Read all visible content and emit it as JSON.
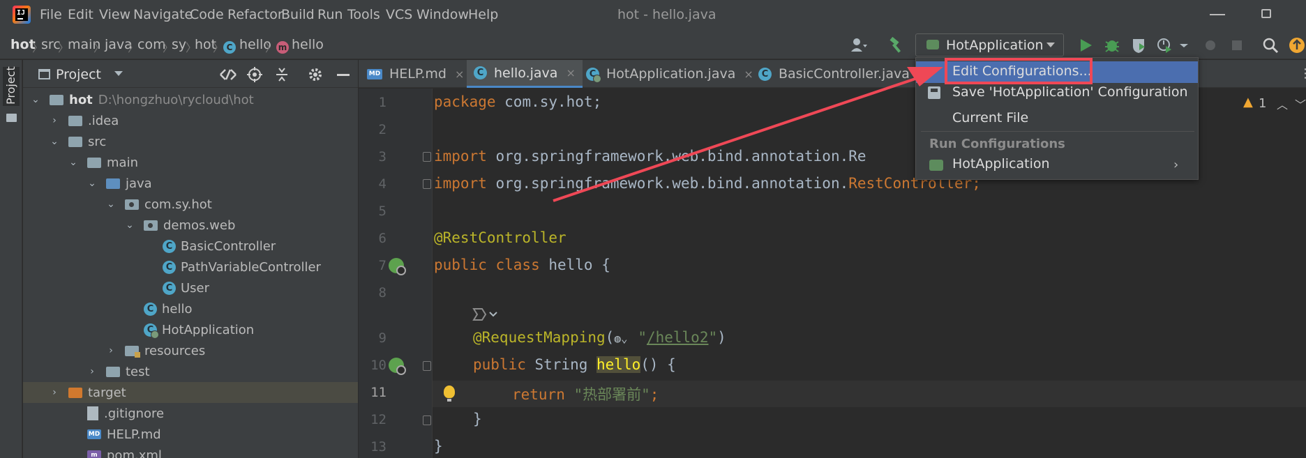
{
  "menubar": {
    "items": [
      "File",
      "Edit",
      "View",
      "Navigate",
      "Code",
      "Refactor",
      "Build",
      "Run",
      "Tools",
      "VCS",
      "Window",
      "Help"
    ],
    "window_title": "hot - hello.java"
  },
  "breadcrumb": [
    "hot",
    "src",
    "main",
    "java",
    "com",
    "sy",
    "hot",
    "hello",
    "hello"
  ],
  "run_config": {
    "selected": "HotApplication"
  },
  "left_strip": {
    "label": "Project"
  },
  "project_panel": {
    "title": "Project",
    "tree": [
      {
        "label": "hot",
        "extra": "D:\\hongzhuo\\rycloud\\hot"
      },
      {
        "label": ".idea"
      },
      {
        "label": "src"
      },
      {
        "label": "main"
      },
      {
        "label": "java"
      },
      {
        "label": "com.sy.hot"
      },
      {
        "label": "demos.web"
      },
      {
        "label": "BasicController"
      },
      {
        "label": "PathVariableController"
      },
      {
        "label": "User"
      },
      {
        "label": "hello"
      },
      {
        "label": "HotApplication"
      },
      {
        "label": "resources"
      },
      {
        "label": "test"
      },
      {
        "label": "target"
      },
      {
        "label": ".gitignore"
      },
      {
        "label": "HELP.md"
      },
      {
        "label": "pom.xml"
      }
    ],
    "md_badge": "MD",
    "class_badge": "C"
  },
  "tabs": [
    {
      "label": "HELP.md",
      "badge": "MD"
    },
    {
      "label": "hello.java",
      "badge": "C"
    },
    {
      "label": "HotApplication.java",
      "badge": "C"
    },
    {
      "label": "BasicController.java",
      "badge": "C"
    }
  ],
  "tab_close": "×",
  "editor": {
    "line_numbers": [
      "1",
      "2",
      "3",
      "4",
      "5",
      "6",
      "7",
      "8",
      "9",
      "10",
      "11",
      "12",
      "13"
    ],
    "code": {
      "l1_kw": "package",
      "l1_rest": " com.sy.hot;",
      "l3_kw": "import",
      "l3_rest": " org.springframework.web.bind.annotation.Re",
      "l4_kw": "import",
      "l4_rest": " org.springframework.web.bind.annotation.",
      "l4_tail": "RestController;",
      "l6_ann": "@RestController",
      "l7_kw": "public class",
      "l7_rest": " hello {",
      "l9_ann": "@RequestMapping",
      "l9_open": "(",
      "l9_q1": "\"",
      "l9_url": "/hello2",
      "l9_q2": "\"",
      "l9_close": ")",
      "l10_kw": "public",
      "l10_type": " String ",
      "l10_name": "hello",
      "l10_rest": "() {",
      "l11_kw": "return",
      "l11_str": " \"热部署前\"",
      "l11_semi": ";",
      "l12": "}",
      "l13": "}"
    },
    "warning_count": "1"
  },
  "popup": {
    "items": [
      "Edit Configurations...",
      "Save 'HotApplication' Configuration",
      "Current File"
    ],
    "section_title": "Run Configurations",
    "run_config_item": "HotApplication"
  },
  "colors": {
    "accent_selection": "#4b6eaf",
    "annotation_red": "#ef4856",
    "keyword": "#cc7832",
    "annotation": "#bbb529",
    "string": "#6a8759"
  }
}
